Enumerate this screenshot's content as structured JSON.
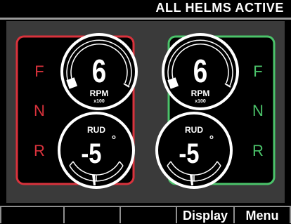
{
  "header": {
    "title": "ALL HELMS ACTIVE"
  },
  "colors": {
    "port": "#d9323c",
    "starboard": "#4bc36a",
    "panel": "#3a3a3a",
    "gauge_ring": "#ffffff"
  },
  "helms": [
    {
      "side": "port",
      "gears": [
        "F",
        "N",
        "R"
      ],
      "rpm": {
        "value": "6",
        "label": "RPM",
        "unit": "x100"
      },
      "rudder": {
        "label": "RUD",
        "value": "-5",
        "unit": "°"
      }
    },
    {
      "side": "starboard",
      "gears": [
        "F",
        "N",
        "R"
      ],
      "rpm": {
        "value": "6",
        "label": "RPM",
        "unit": "x100"
      },
      "rudder": {
        "label": "RUD",
        "value": "-5",
        "unit": "°"
      }
    }
  ],
  "softkeys": [
    "",
    "",
    "",
    "Display",
    "Menu"
  ]
}
